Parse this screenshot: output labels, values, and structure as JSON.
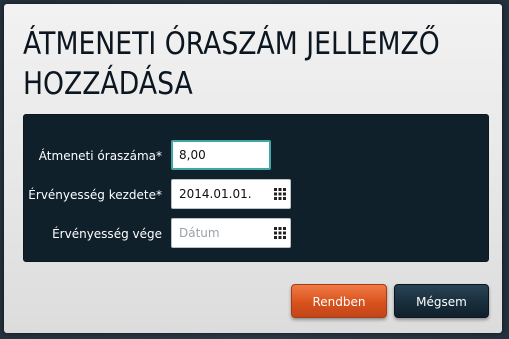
{
  "dialog": {
    "title": "ÁTMENETI ÓRASZÁM JELLEMZŐ HOZZÁDÁSA"
  },
  "form": {
    "hours": {
      "label": "Átmeneti óraszáma*",
      "value": "8,00"
    },
    "valid_from": {
      "label": "Érvényesség kezdete*",
      "value": "2014.01.01."
    },
    "valid_to": {
      "label": "Érvényesség vége",
      "value": "",
      "placeholder": "Dátum"
    }
  },
  "buttons": {
    "ok_label": "Rendben",
    "cancel_label": "Mégsem"
  },
  "colors": {
    "panel_bg": "#0f202b",
    "ok_button": "#d9521d",
    "cancel_button": "#172c3a",
    "focus_border": "#3fa7a8"
  },
  "icons": {
    "date_picker": "calendar-grid-icon"
  }
}
